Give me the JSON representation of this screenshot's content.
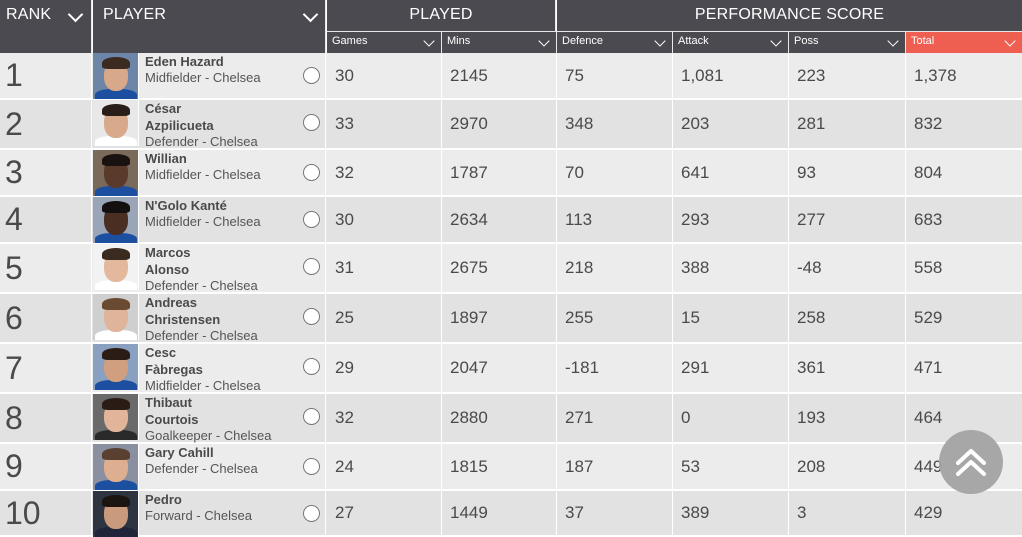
{
  "header": {
    "rank": "RANK",
    "player": "PLAYER",
    "played": "PLAYED",
    "performance": "PERFORMANCE SCORE",
    "sub": {
      "games": "Games",
      "mins": "Mins",
      "defence": "Defence",
      "attack": "Attack",
      "poss": "Poss",
      "total": "Total"
    }
  },
  "colors": {
    "header_bg": "#4b4a51",
    "total_accent": "#ee5f52",
    "row_light": "#ececec",
    "row_dark": "#e2e2e2"
  },
  "rows": [
    {
      "rank": "1",
      "name1": "Eden Hazard",
      "name2": "",
      "position": "Midfielder - Chelsea",
      "games": "30",
      "mins": "2145",
      "defence": "75",
      "attack": "1,081",
      "poss": "223",
      "total": "1,378"
    },
    {
      "rank": "2",
      "name1": "César",
      "name2": "Azpilicueta",
      "position": "Defender - Chelsea",
      "games": "33",
      "mins": "2970",
      "defence": "348",
      "attack": "203",
      "poss": "281",
      "total": "832"
    },
    {
      "rank": "3",
      "name1": "Willian",
      "name2": "",
      "position": "Midfielder - Chelsea",
      "games": "32",
      "mins": "1787",
      "defence": "70",
      "attack": "641",
      "poss": "93",
      "total": "804"
    },
    {
      "rank": "4",
      "name1": "N'Golo Kanté",
      "name2": "",
      "position": "Midfielder - Chelsea",
      "games": "30",
      "mins": "2634",
      "defence": "113",
      "attack": "293",
      "poss": "277",
      "total": "683"
    },
    {
      "rank": "5",
      "name1": "Marcos",
      "name2": "Alonso",
      "position": "Defender - Chelsea",
      "games": "31",
      "mins": "2675",
      "defence": "218",
      "attack": "388",
      "poss": "-48",
      "total": "558"
    },
    {
      "rank": "6",
      "name1": "Andreas",
      "name2": "Christensen",
      "position": "Defender - Chelsea",
      "games": "25",
      "mins": "1897",
      "defence": "255",
      "attack": "15",
      "poss": "258",
      "total": "529"
    },
    {
      "rank": "7",
      "name1": "Cesc",
      "name2": "Fàbregas",
      "position": "Midfielder - Chelsea",
      "games": "29",
      "mins": "2047",
      "defence": "-181",
      "attack": "291",
      "poss": "361",
      "total": "471"
    },
    {
      "rank": "8",
      "name1": "Thibaut",
      "name2": "Courtois",
      "position": "Goalkeeper - Chelsea",
      "games": "32",
      "mins": "2880",
      "defence": "271",
      "attack": "0",
      "poss": "193",
      "total": "464"
    },
    {
      "rank": "9",
      "name1": "Gary Cahill",
      "name2": "",
      "position": "Defender - Chelsea",
      "games": "24",
      "mins": "1815",
      "defence": "187",
      "attack": "53",
      "poss": "208",
      "total": "449"
    },
    {
      "rank": "10",
      "name1": "Pedro",
      "name2": "",
      "position": "Forward - Chelsea",
      "games": "27",
      "mins": "1449",
      "defence": "37",
      "attack": "389",
      "poss": "3",
      "total": "429"
    }
  ]
}
